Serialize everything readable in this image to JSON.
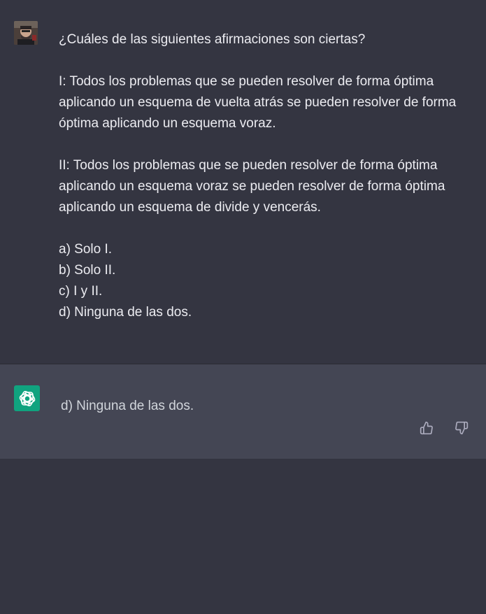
{
  "user_message": {
    "avatar": "user-avatar-photo",
    "question": "¿Cuáles de las siguientes afirmaciones son ciertas?",
    "statement_1": "I: Todos los problemas que se pueden resolver de forma óptima aplicando un esquema de vuelta atrás se pueden resolver de forma óptima aplicando un esquema voraz.",
    "statement_2": "II: Todos los problemas que se pueden resolver de forma óptima aplicando un esquema voraz se pueden resolver de forma óptima aplicando un esquema de divide y vencerás.",
    "options": [
      "a) Solo I.",
      "b) Solo II.",
      "c) I y II.",
      "d) Ninguna de las dos."
    ]
  },
  "assistant_message": {
    "avatar": "chatgpt-logo-icon",
    "text": "d) Ninguna de las dos.",
    "feedback_icons": [
      "thumbs-up-icon",
      "thumbs-down-icon"
    ]
  },
  "colors": {
    "background": "#343541",
    "assistant_background": "#444654",
    "brand_green": "#10a37f",
    "text_primary": "#ececf1",
    "text_secondary": "#d1d5db",
    "icon_gray": "#acacbe"
  }
}
